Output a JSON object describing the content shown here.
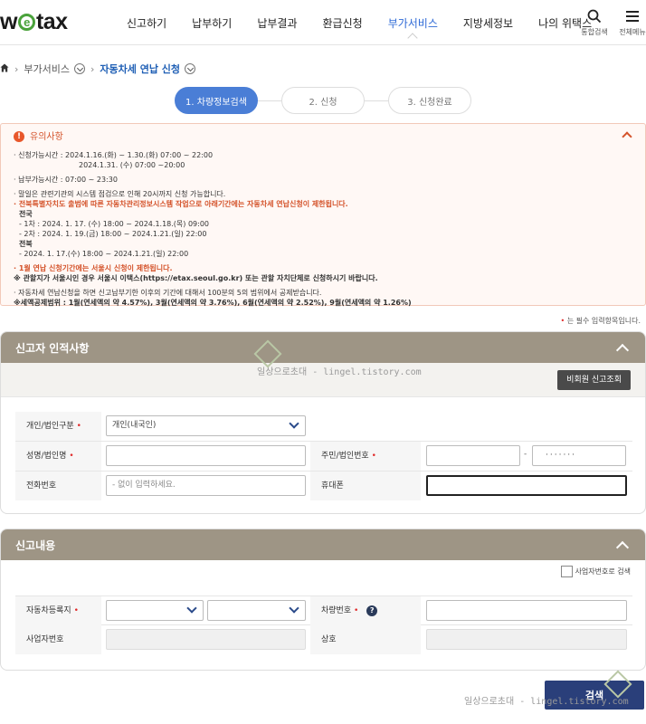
{
  "header": {
    "logo_pre": "w",
    "logo_e": "e",
    "logo_post": "tax",
    "nav": [
      "신고하기",
      "납부하기",
      "납부결과",
      "환급신청",
      "부가서비스",
      "지방세정보",
      "나의 위택스"
    ],
    "active_nav": "부가서비스",
    "search_label": "통합검색",
    "menu_label": "전체메뉴"
  },
  "breadcrumb": {
    "level1": "부가서비스",
    "current": "자동차세 연납 신청"
  },
  "steps": [
    "1. 차량정보검색",
    "2. 신청",
    "3. 신청완료"
  ],
  "notice": {
    "title": "유의사항",
    "lines": [
      "· 신청가능시간 : 2024.1.16.(화) ~ 1.30.(화) 07:00 ~ 22:00",
      "2024.1.31. (수) 07:00 ~20:00",
      "· 납부가능시간 : 07:00 ~ 23:30",
      "· 말일은 관련기관의 시스템 점검으로 인해 20시까지 신청 가능합니다.",
      "· 전북특별자치도 출범에 따른 자동차관리정보시스템 작업으로 아래기간에는 자동차세 연납신청이 제한됩니다.",
      "전국",
      "- 1차 : 2024. 1. 17. (수) 18:00 ~ 2024.1.18.(목) 09:00",
      "- 2차 : 2024. 1. 19.(금) 18:00 ~ 2024.1.21.(일) 22:00",
      "전북",
      "- 2024. 1. 17.(수) 18:00 ~ 2024.1.21.(일) 22:00",
      "· 1월 연납 신청기간에는 서울시 신청이 제한됩니다.",
      "※ 관할지가 서울시인 경우 서울시 이택스(https://etax.seoul.go.kr) 또는 관할 자치단체로 신청하시기 바랍니다.",
      "· 자동차세 연납신청을 하면 신고납부기한 이후의 기간에 대해서 100분의 5의 범위에서 공제받습니다.",
      "※세액공제범위 : 1월(연세액의 약 4.57%), 3월(연세액의 약 3.76%), 6월(연세액의 약 2.52%), 9월(연세액의 약 1.26%)"
    ]
  },
  "required_note": {
    "mark": "•",
    "text": "는 필수 입력항목입니다."
  },
  "section1": {
    "title": "신고자 인적사항",
    "button": "비회원 신고조회",
    "fields": {
      "type_label": "개인/법인구분",
      "type_value": "개인(내국인)",
      "name_label": "성명/법인명",
      "rrn_label": "주민/법인번호",
      "rrn_mask": "·······",
      "rrn_dash": "-",
      "phone_label": "전화번호",
      "phone_placeholder": "- 없이 입력하세요.",
      "mobile_label": "휴대폰"
    }
  },
  "section2": {
    "title": "신고내용",
    "checkbox_label": "사업자번호로 검색",
    "fields": {
      "region_label": "자동차등록지",
      "car_label": "차량번호",
      "biz_label": "사업자번호",
      "company_label": "상호"
    }
  },
  "required_mark": "•",
  "search_button": "검색",
  "watermark": {
    "text1": "일상으로초대  - lingel.tistory.com",
    "text2": "일상으로초대 - lingel.tistory.com"
  },
  "colors": {
    "accent": "#4a7ed6",
    "section_header": "#9e9585",
    "notice_orange": "#d4532b",
    "primary_button": "#2a3f7a"
  }
}
